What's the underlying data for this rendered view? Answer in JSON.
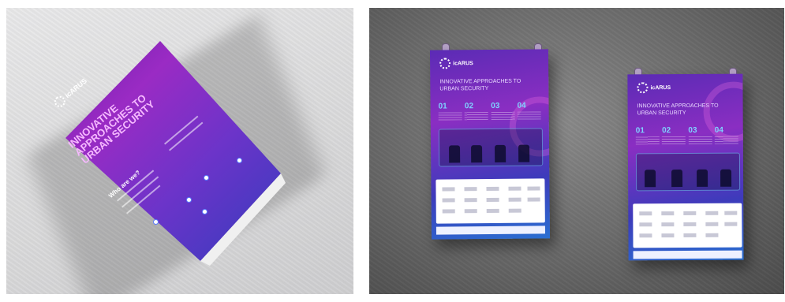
{
  "brochure": {
    "logo_text": "icARUS",
    "title": "INNOVATIVE APPROACHES TO URBAN SECURITY",
    "section_heading": "Who are we?"
  },
  "poster_left": {
    "logo_text": "icARUS",
    "title": "INNOVATIVE APPROACHES TO URBAN SECURITY",
    "numbers": [
      "01",
      "02",
      "03",
      "04"
    ]
  },
  "poster_right": {
    "logo_text": "icARUS",
    "title": "INNOVATIVE APPROACHES TO URBAN SECURITY",
    "numbers": [
      "01",
      "02",
      "03",
      "04"
    ]
  },
  "colors": {
    "purple": "#8a2ec2",
    "blue": "#2a6fd1",
    "background_left": "#dadadb",
    "background_right": "#6f6f6f"
  }
}
